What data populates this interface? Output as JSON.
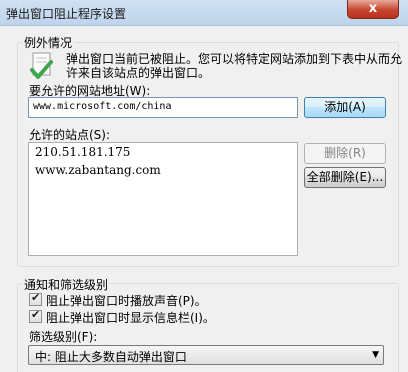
{
  "window": {
    "title": "弹出窗口阻止程序设置",
    "close_glyph": "x"
  },
  "exceptions": {
    "group_title": "例外情况",
    "description_line1": "弹出窗口当前已被阻止。您可以将特定网站添加到下表中从而允",
    "description_line2": "许来自该站点的弹出窗口。",
    "address_label": "要允许的网站地址(W):",
    "address_value": "www.microsoft.com/china",
    "add_button": "添加(A)",
    "allowed_sites_label": "允许的站点(S):",
    "allowed_sites": [
      "210.51.181.175",
      "www.zabantang.com"
    ],
    "remove_button": "删除(R)",
    "remove_all_button": "全部删除(E)..."
  },
  "notifications": {
    "group_title": "通知和筛选级别",
    "play_sound_label": "阻止弹出窗口时播放声音(P)。",
    "play_sound_checked": true,
    "show_bar_label": "阻止弹出窗口时显示信息栏(I)。",
    "show_bar_checked": true,
    "filter_level_label": "筛选级别(F):",
    "filter_level_value": "中: 阻止大多数自动弹出窗口"
  },
  "icons": {
    "info": "shield-check-icon",
    "dropdown": "chevron-down-icon",
    "close": "close-icon"
  },
  "colors": {
    "titlebar": "#bed4ec",
    "close_button": "#c7452f",
    "primary_button": "#bee6fd",
    "window_bg": "#f0f0f0"
  }
}
